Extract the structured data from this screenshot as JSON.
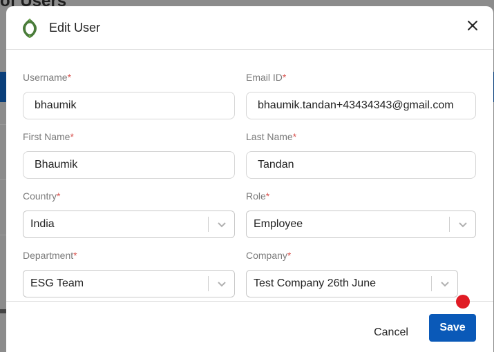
{
  "background": {
    "page_title": "of Users"
  },
  "modal": {
    "title": "Edit User",
    "close_icon": "close-icon",
    "logo_icon": "leaf-ring-logo"
  },
  "form": {
    "username": {
      "label": "Username",
      "required_mark": "*",
      "value": "bhaumik"
    },
    "email": {
      "label": "Email ID",
      "required_mark": "*",
      "value": "bhaumik.tandan+43434343@gmail.com"
    },
    "first_name": {
      "label": "First Name",
      "required_mark": "*",
      "value": "Bhaumik"
    },
    "last_name": {
      "label": "Last Name",
      "required_mark": "*",
      "value": "Tandan"
    },
    "country": {
      "label": "Country",
      "required_mark": "*",
      "value": "India"
    },
    "role": {
      "label": "Role",
      "required_mark": "*",
      "value": "Employee"
    },
    "department": {
      "label": "Department",
      "required_mark": "*",
      "value": "ESG Team"
    },
    "company": {
      "label": "Company",
      "required_mark": "*",
      "value": "Test Company 26th June"
    }
  },
  "footer": {
    "cancel_label": "Cancel",
    "save_label": "Save"
  },
  "colors": {
    "primary": "#0a59b8",
    "required": "#d9534f",
    "notification": "#e01b24",
    "logo_green": "#4a7c3a"
  }
}
